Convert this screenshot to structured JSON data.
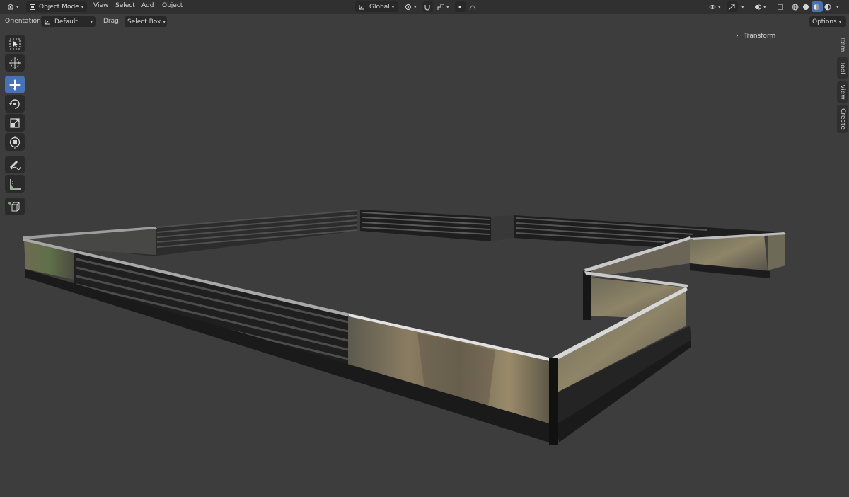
{
  "header": {
    "editor_type_icon": "editor-type-icon",
    "mode_label": "Object Mode",
    "menus": [
      "View",
      "Select",
      "Add",
      "Object"
    ],
    "transform_orientation": "Global"
  },
  "tool_settings": {
    "orientation_label": "Orientation:",
    "orientation_value": "Default",
    "drag_label": "Drag:",
    "drag_value": "Select Box",
    "options_label": "Options"
  },
  "toolbar": {
    "tools": [
      "select-box",
      "cursor",
      "move",
      "rotate",
      "scale",
      "transform",
      "annotate",
      "measure",
      "add-cube"
    ],
    "active_tool": "move"
  },
  "npanel": {
    "tabs": [
      "Item",
      "Tool",
      "View",
      "Create"
    ],
    "active_tab": "Item",
    "panel_title": "Transform"
  },
  "colors": {
    "header_bg": "#303030",
    "viewport_bg": "#3d3d3d",
    "active_tool": "#4772b3",
    "button_bg": "#282828"
  }
}
